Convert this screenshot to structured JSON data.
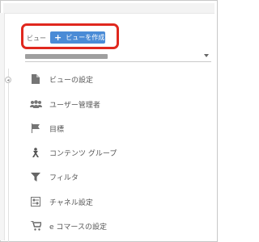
{
  "header": {
    "view_label": "ビュー",
    "create_view_button": "ビューを作成",
    "create_view_plus": "+"
  },
  "menu": {
    "items": [
      {
        "label": "ビューの設定",
        "icon": "document-icon"
      },
      {
        "label": "ユーザー管理者",
        "icon": "users-icon"
      },
      {
        "label": "目標",
        "icon": "flag-icon"
      },
      {
        "label": "コンテンツ グループ",
        "icon": "person-hierarchy-icon"
      },
      {
        "label": "フィルタ",
        "icon": "funnel-icon"
      },
      {
        "label": "チャネル設定",
        "icon": "channel-settings-icon"
      },
      {
        "label": "e コマースの設定",
        "icon": "shopping-cart-icon"
      }
    ]
  },
  "colors": {
    "accent": "#4a8bd6",
    "highlight": "#e0281e"
  }
}
